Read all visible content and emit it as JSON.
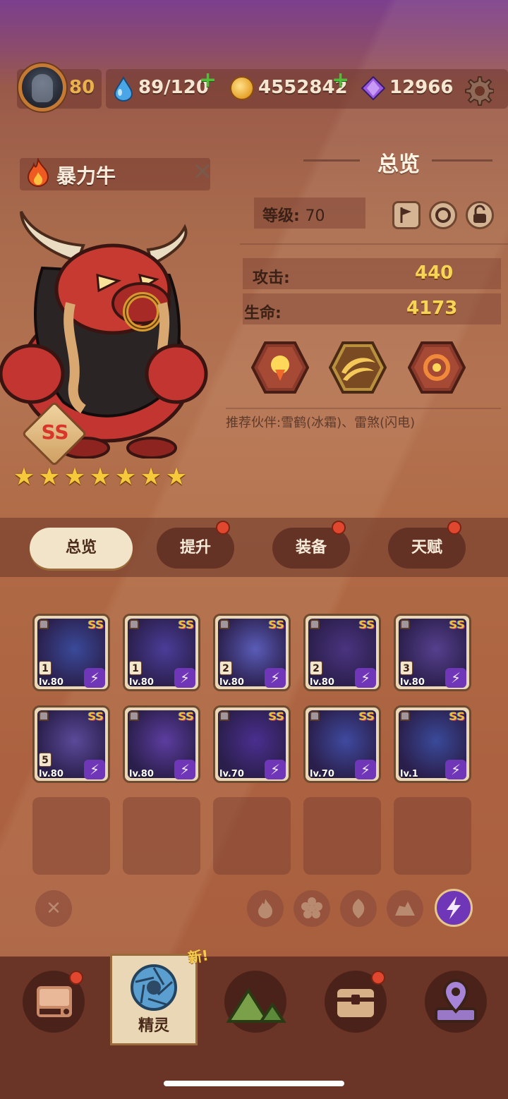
{
  "topbar": {
    "level": "80",
    "stamina": "89/120",
    "coins": "4552842",
    "gems": "12966",
    "plus_symbol": "+"
  },
  "hero": {
    "name": "暴力牛",
    "rank": "SS",
    "stars": 7
  },
  "overview": {
    "title": "总览",
    "level_label": "等级:",
    "level_value": "70",
    "attack_label": "攻击:",
    "attack_value": "440",
    "hp_label": "生命:",
    "hp_value": "4173",
    "recommend_text": "推荐伙伴:雪鹤(冰霜)、雷煞(闪电)"
  },
  "tabs": [
    {
      "label": "总览",
      "active": true,
      "dot": false
    },
    {
      "label": "提升",
      "active": false,
      "dot": true
    },
    {
      "label": "装备",
      "active": false,
      "dot": true
    },
    {
      "label": "天赋",
      "active": false,
      "dot": true
    }
  ],
  "pets": [
    {
      "lv": "lv.80",
      "num": "1",
      "rank": "SS",
      "color": "#3a4a9a"
    },
    {
      "lv": "lv.80",
      "num": "1",
      "rank": "SS",
      "color": "#4a3d99"
    },
    {
      "lv": "lv.80",
      "num": "2",
      "rank": "SS",
      "color": "#5a5cb8"
    },
    {
      "lv": "lv.80",
      "num": "2",
      "rank": "SS",
      "color": "#4a3480"
    },
    {
      "lv": "lv.80",
      "num": "3",
      "rank": "SS",
      "color": "#55408e"
    },
    {
      "lv": "lv.80",
      "num": "5",
      "rank": "SS",
      "color": "#5a4a9a"
    },
    {
      "lv": "lv.80",
      "num": "",
      "rank": "SS",
      "color": "#5c3da0"
    },
    {
      "lv": "lv.70",
      "num": "",
      "rank": "SS",
      "color": "#4a2f90"
    },
    {
      "lv": "lv.70",
      "num": "",
      "rank": "SS",
      "color": "#3f4aa0"
    },
    {
      "lv": "lv.1",
      "num": "",
      "rank": "SS",
      "color": "#3a4a9a"
    }
  ],
  "nav": {
    "selected_label": "精灵",
    "new_tag": "新!"
  },
  "colors": {
    "accent_purple": "#6f36b8",
    "stat_gold": "#f6d456",
    "red_dot": "#e0472e"
  }
}
